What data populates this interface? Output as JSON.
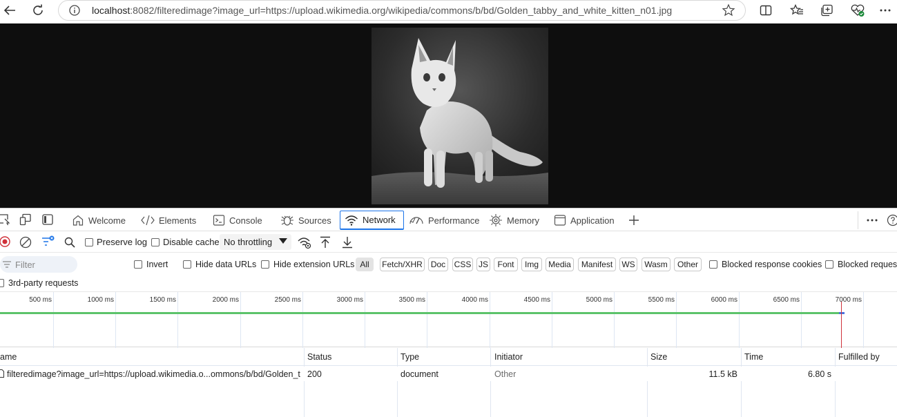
{
  "browser": {
    "url_host": "localhost",
    "url_rest": ":8082/filteredimage?image_url=https://upload.wikimedia.org/wikipedia/commons/b/bd/Golden_tabby_and_white_kitten_n01.jpg",
    "icons": [
      "back-arrow-icon",
      "reload-icon",
      "info-icon",
      "star-icon",
      "split-screen-icon",
      "favorites-icon",
      "collections-icon",
      "browser-essentials-icon",
      "more-icon"
    ]
  },
  "devtools": {
    "tabs": [
      {
        "label": "Welcome",
        "icon": "home-icon"
      },
      {
        "label": "Elements",
        "icon": "code-icon"
      },
      {
        "label": "Console",
        "icon": "console-icon"
      },
      {
        "label": "Sources",
        "icon": "bug-icon"
      },
      {
        "label": "Network",
        "icon": "wifi-icon",
        "active": true
      },
      {
        "label": "Performance",
        "icon": "gauge-icon"
      },
      {
        "label": "Memory",
        "icon": "chip-icon"
      },
      {
        "label": "Application",
        "icon": "window-icon"
      }
    ],
    "toolbar": {
      "preserve_log": "Preserve log",
      "disable_cache": "Disable cache",
      "throttling": "No throttling"
    },
    "filter": {
      "placeholder": "Filter",
      "invert": "Invert",
      "hide_data_urls": "Hide data URLs",
      "hide_extension_urls": "Hide extension URLs",
      "types": [
        "All",
        "Fetch/XHR",
        "Doc",
        "CSS",
        "JS",
        "Font",
        "Img",
        "Media",
        "Manifest",
        "WS",
        "Wasm",
        "Other"
      ],
      "blocked_response_cookies": "Blocked response cookies",
      "blocked_requests": "Blocked requests",
      "third_party": "3rd-party requests"
    },
    "timeline": {
      "ticks": [
        "500 ms",
        "1000 ms",
        "1500 ms",
        "2000 ms",
        "2500 ms",
        "3000 ms",
        "3500 ms",
        "4000 ms",
        "4500 ms",
        "5000 ms",
        "5500 ms",
        "6000 ms",
        "6500 ms",
        "7000 ms"
      ]
    },
    "table": {
      "columns": [
        "ame",
        "Status",
        "Type",
        "Initiator",
        "Size",
        "Time",
        "Fulfilled by"
      ],
      "rows": [
        {
          "name": "filteredimage?image_url=https://upload.wikimedia.o...ommons/b/bd/Golden_t...",
          "status": "200",
          "type": "document",
          "initiator": "Other",
          "size": "11.5 kB",
          "time": "6.80 s",
          "fulfilled_by": ""
        }
      ]
    }
  }
}
